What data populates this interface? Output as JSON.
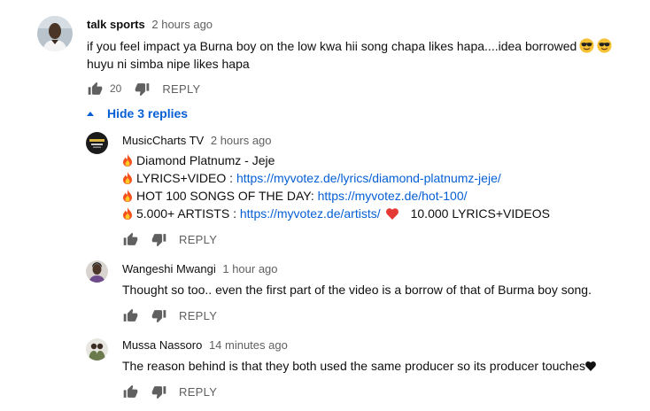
{
  "comments": [
    {
      "author": "talk sports",
      "time": "2 hours ago",
      "line1": "if you feel impact ya Burna boy on the low kwa hii song chapa likes hapa....idea borrowed",
      "line2": "huyu ni simba nipe likes hapa",
      "like_count": "20",
      "reply_label": "REPLY",
      "emoji": [
        "cool-face",
        "cool-face"
      ]
    }
  ],
  "toggle_replies_label": "Hide 3 replies",
  "replies": [
    {
      "author": "MusicCharts TV",
      "time": "2 hours ago",
      "lines": [
        {
          "icon": "fire",
          "text": "Diamond Platnumz - Jeje",
          "link": ""
        },
        {
          "icon": "fire",
          "text": "LYRICS+VIDEO : ",
          "link": "https://myvotez.de/lyrics/diamond-platnumz-jeje/"
        },
        {
          "icon": "fire",
          "text": "HOT 100 SONGS OF THE DAY: ",
          "link": "https://myvotez.de/hot-100/"
        },
        {
          "icon": "fire",
          "text": "5.000+ ARTISTS : ",
          "link": "https://myvotez.de/artists/",
          "tail": "10.000 LYRICS+VIDEOS"
        }
      ],
      "reply_label": "REPLY"
    },
    {
      "author": "Wangeshi Mwangi",
      "time": "1 hour ago",
      "text": "Thought so too.. even the first part of the video is a borrow of that of Burma boy song.",
      "reply_label": "REPLY"
    },
    {
      "author": "Mussa Nassoro",
      "time": "14 minutes ago",
      "text": "The reason behind is that they both  used the same producer so its producer touches",
      "reply_label": "REPLY"
    }
  ],
  "colors": {
    "link": "#065fd4",
    "meta": "#606060",
    "text": "#0f0f0f",
    "fire": "#f4511e",
    "heart": "#e53935"
  }
}
